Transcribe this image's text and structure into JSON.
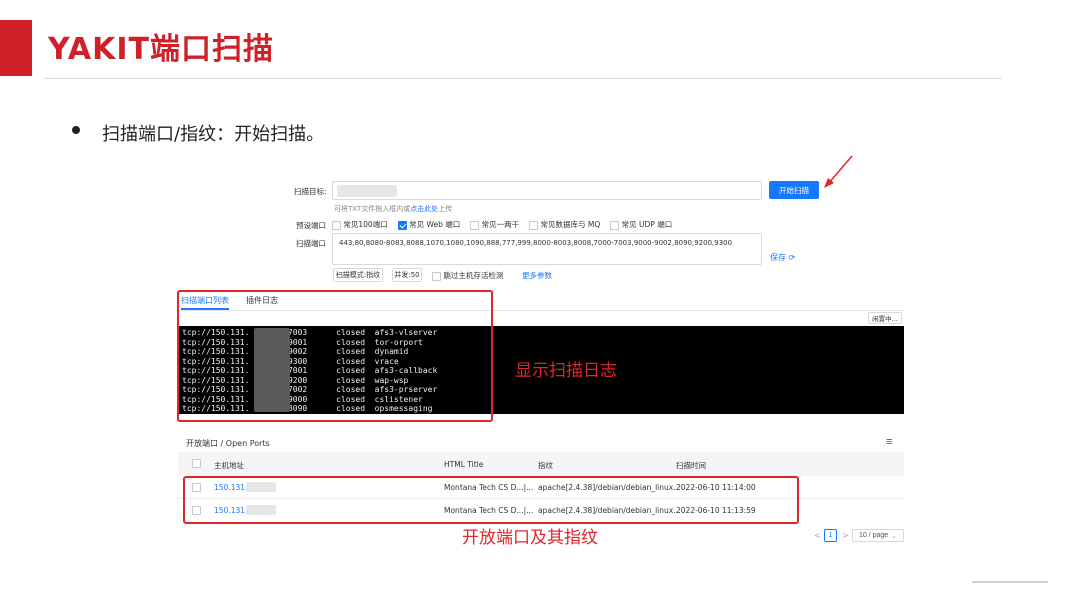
{
  "slide": {
    "title": "YAKIT端口扫描",
    "bullet": "扫描端口/指纹：开始扫描。"
  },
  "form": {
    "target_label": "扫描目标:",
    "upload_hint_prefix": "可将TXT文件拖入框内或",
    "upload_link": "点击此处",
    "upload_hint_suffix": "上传",
    "start_button": "开始扫描",
    "preset_label": "预设端口",
    "presets": [
      {
        "label": "常见100端口",
        "checked": false
      },
      {
        "label": "常见 Web 端口",
        "checked": true
      },
      {
        "label": "常见一两千",
        "checked": false
      },
      {
        "label": "常见数据库与 MQ",
        "checked": false
      },
      {
        "label": "常见 UDP 端口",
        "checked": false
      }
    ],
    "ports_label": "扫描端口",
    "ports_value": "443,80,8080-8083,8088,1070,1080,1090,888,777,999,8000-8003,8008,7000-7003,9000-9002,8090,9200,9300",
    "save_label": "保存",
    "mode_button": "扫描模式:指纹",
    "concurrency_button": "并发:50",
    "skip_label": "跳过主机存活检测",
    "more_params": "更多参数"
  },
  "tabs": {
    "active": "扫描端口列表",
    "other": "插件日志"
  },
  "log_button": "闲置中...",
  "terminal_lines": [
    "tcp://150.131.       :7003      closed  afs3-vlserver",
    "tcp://150.131.       :9001      closed  tor-orport",
    "tcp://150.131.       :9002      closed  dynamid",
    "tcp://150.131.       :9300      closed  vrace",
    "tcp://150.131.       :7001      closed  afs3-callback",
    "tcp://150.131.       :9200      closed  wap-wsp",
    "tcp://150.131.       :7002      closed  afs3-prserver",
    "tcp://150.131.       :9000      closed  cslistener",
    "tcp://150.131.       :8090      closed  opsmessaging"
  ],
  "annotations": {
    "log": "显示扫描日志",
    "ports": "开放端口及其指纹"
  },
  "open_ports": {
    "title": "开放端口 / Open Ports",
    "columns": [
      "主机地址",
      "HTML Title",
      "指纹",
      "扫描时间"
    ],
    "rows": [
      {
        "host": "150.131.        :443",
        "title": "Montana Tech CS D...|...",
        "fingerprint": "apache[2.4.38]/debian/debian_linux...",
        "time": "2022-06-10 11:14:00"
      },
      {
        "host": "150.131.        :80",
        "title": "Montana Tech CS D...|...",
        "fingerprint": "apache[2.4.38]/debian/debian_linux...",
        "time": "2022-06-10 11:13:59"
      }
    ]
  },
  "pagination": {
    "prev": "<",
    "page": "1",
    "next": ">",
    "size": "10 / page"
  },
  "colors": {
    "brand_red": "#d0202a",
    "annotation_red": "#e0262b",
    "primary_blue": "#1677ff"
  }
}
